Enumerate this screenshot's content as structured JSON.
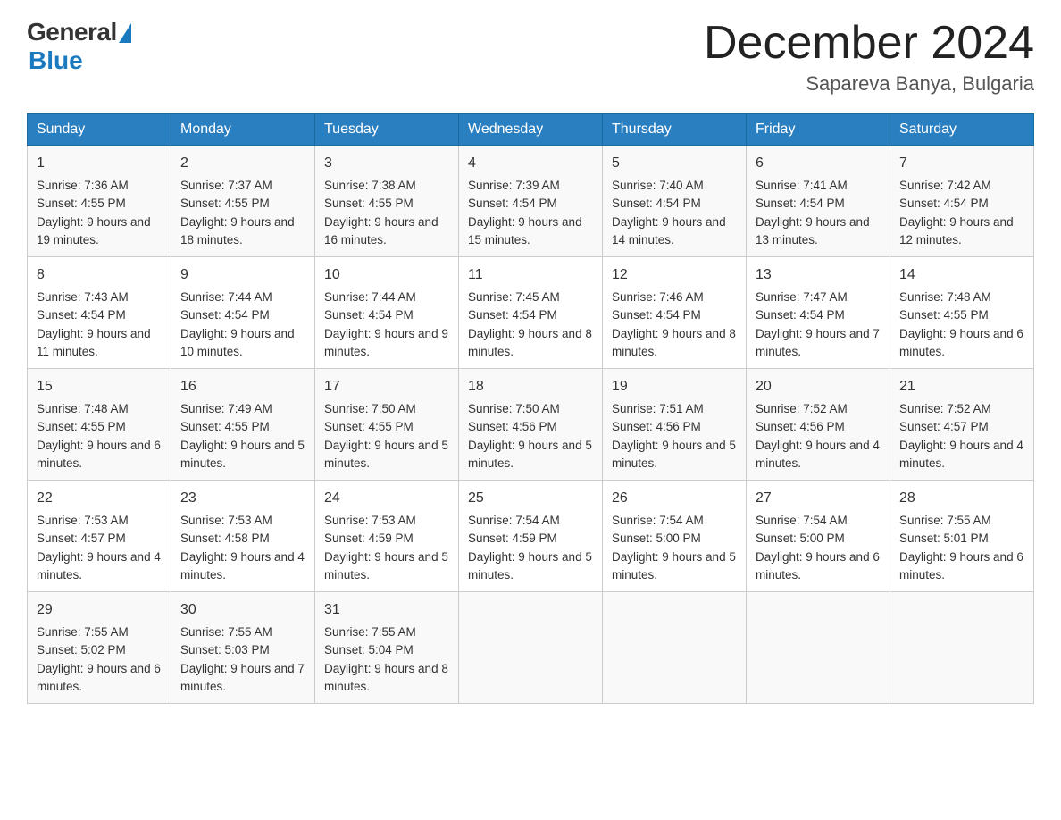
{
  "header": {
    "logo_general": "General",
    "logo_blue": "Blue",
    "month_title": "December 2024",
    "location": "Sapareva Banya, Bulgaria"
  },
  "days": [
    "Sunday",
    "Monday",
    "Tuesday",
    "Wednesday",
    "Thursday",
    "Friday",
    "Saturday"
  ],
  "weeks": [
    [
      {
        "num": "1",
        "sunrise": "7:36 AM",
        "sunset": "4:55 PM",
        "daylight": "9 hours and 19 minutes."
      },
      {
        "num": "2",
        "sunrise": "7:37 AM",
        "sunset": "4:55 PM",
        "daylight": "9 hours and 18 minutes."
      },
      {
        "num": "3",
        "sunrise": "7:38 AM",
        "sunset": "4:55 PM",
        "daylight": "9 hours and 16 minutes."
      },
      {
        "num": "4",
        "sunrise": "7:39 AM",
        "sunset": "4:54 PM",
        "daylight": "9 hours and 15 minutes."
      },
      {
        "num": "5",
        "sunrise": "7:40 AM",
        "sunset": "4:54 PM",
        "daylight": "9 hours and 14 minutes."
      },
      {
        "num": "6",
        "sunrise": "7:41 AM",
        "sunset": "4:54 PM",
        "daylight": "9 hours and 13 minutes."
      },
      {
        "num": "7",
        "sunrise": "7:42 AM",
        "sunset": "4:54 PM",
        "daylight": "9 hours and 12 minutes."
      }
    ],
    [
      {
        "num": "8",
        "sunrise": "7:43 AM",
        "sunset": "4:54 PM",
        "daylight": "9 hours and 11 minutes."
      },
      {
        "num": "9",
        "sunrise": "7:44 AM",
        "sunset": "4:54 PM",
        "daylight": "9 hours and 10 minutes."
      },
      {
        "num": "10",
        "sunrise": "7:44 AM",
        "sunset": "4:54 PM",
        "daylight": "9 hours and 9 minutes."
      },
      {
        "num": "11",
        "sunrise": "7:45 AM",
        "sunset": "4:54 PM",
        "daylight": "9 hours and 8 minutes."
      },
      {
        "num": "12",
        "sunrise": "7:46 AM",
        "sunset": "4:54 PM",
        "daylight": "9 hours and 8 minutes."
      },
      {
        "num": "13",
        "sunrise": "7:47 AM",
        "sunset": "4:54 PM",
        "daylight": "9 hours and 7 minutes."
      },
      {
        "num": "14",
        "sunrise": "7:48 AM",
        "sunset": "4:55 PM",
        "daylight": "9 hours and 6 minutes."
      }
    ],
    [
      {
        "num": "15",
        "sunrise": "7:48 AM",
        "sunset": "4:55 PM",
        "daylight": "9 hours and 6 minutes."
      },
      {
        "num": "16",
        "sunrise": "7:49 AM",
        "sunset": "4:55 PM",
        "daylight": "9 hours and 5 minutes."
      },
      {
        "num": "17",
        "sunrise": "7:50 AM",
        "sunset": "4:55 PM",
        "daylight": "9 hours and 5 minutes."
      },
      {
        "num": "18",
        "sunrise": "7:50 AM",
        "sunset": "4:56 PM",
        "daylight": "9 hours and 5 minutes."
      },
      {
        "num": "19",
        "sunrise": "7:51 AM",
        "sunset": "4:56 PM",
        "daylight": "9 hours and 5 minutes."
      },
      {
        "num": "20",
        "sunrise": "7:52 AM",
        "sunset": "4:56 PM",
        "daylight": "9 hours and 4 minutes."
      },
      {
        "num": "21",
        "sunrise": "7:52 AM",
        "sunset": "4:57 PM",
        "daylight": "9 hours and 4 minutes."
      }
    ],
    [
      {
        "num": "22",
        "sunrise": "7:53 AM",
        "sunset": "4:57 PM",
        "daylight": "9 hours and 4 minutes."
      },
      {
        "num": "23",
        "sunrise": "7:53 AM",
        "sunset": "4:58 PM",
        "daylight": "9 hours and 4 minutes."
      },
      {
        "num": "24",
        "sunrise": "7:53 AM",
        "sunset": "4:59 PM",
        "daylight": "9 hours and 5 minutes."
      },
      {
        "num": "25",
        "sunrise": "7:54 AM",
        "sunset": "4:59 PM",
        "daylight": "9 hours and 5 minutes."
      },
      {
        "num": "26",
        "sunrise": "7:54 AM",
        "sunset": "5:00 PM",
        "daylight": "9 hours and 5 minutes."
      },
      {
        "num": "27",
        "sunrise": "7:54 AM",
        "sunset": "5:00 PM",
        "daylight": "9 hours and 6 minutes."
      },
      {
        "num": "28",
        "sunrise": "7:55 AM",
        "sunset": "5:01 PM",
        "daylight": "9 hours and 6 minutes."
      }
    ],
    [
      {
        "num": "29",
        "sunrise": "7:55 AM",
        "sunset": "5:02 PM",
        "daylight": "9 hours and 6 minutes."
      },
      {
        "num": "30",
        "sunrise": "7:55 AM",
        "sunset": "5:03 PM",
        "daylight": "9 hours and 7 minutes."
      },
      {
        "num": "31",
        "sunrise": "7:55 AM",
        "sunset": "5:04 PM",
        "daylight": "9 hours and 8 minutes."
      },
      null,
      null,
      null,
      null
    ]
  ]
}
